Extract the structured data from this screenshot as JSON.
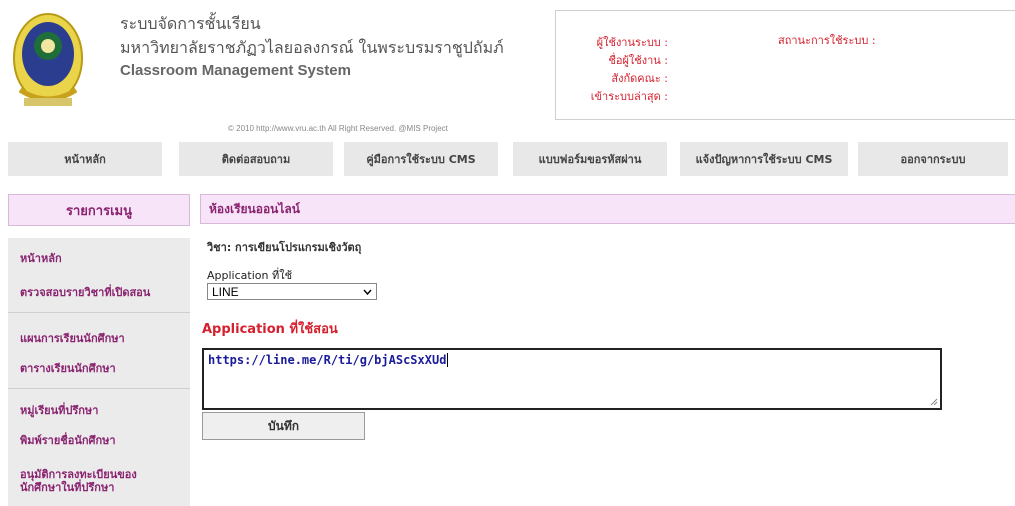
{
  "header": {
    "title_th": "ระบบจัดการชั้นเรียน",
    "university": "มหาวิทยาลัยราชภัฏวไลยอลงกรณ์ ในพระบรมราชูปถัมภ์",
    "title_en": "Classroom Management System",
    "copyright": "© 2010 http://www.vru.ac.th All Right Reserved. @MIS Project"
  },
  "user_box": {
    "user_label": "ผู้ใช้งานระบบ :",
    "name_label": "ชื่อผู้ใช้งาน :",
    "faculty_label": "สังกัดคณะ :",
    "last_login_label": "เข้าระบบล่าสุด :",
    "status_label": "สถานะการใช้ระบบ :"
  },
  "nav": {
    "home": "หน้าหลัก",
    "contact": "ติดต่อสอบถาม",
    "manual": "คู่มือการใช้ระบบ CMS",
    "password_form": "แบบฟอร์มขอรหัสผ่าน",
    "report": "แจ้งปัญหาการใช้ระบบ CMS",
    "logout": "ออกจากระบบ"
  },
  "sidebar": {
    "header": "รายการเมนู",
    "items": [
      "หน้าหลัก",
      "ตรวจสอบรายวิชาที่เปิดสอน",
      "แผนการเรียนนักศึกษา",
      "ตารางเรียนนักศึกษา",
      "หมู่เรียนที่ปรึกษา",
      "พิมพ์รายชื่อนักศึกษา",
      "อนุมัติการลงทะเบียนของ\nนักศึกษาในที่ปรึกษา"
    ]
  },
  "main": {
    "header": "ห้องเรียนออนไลน์",
    "subject": "วิชา: การเขียนโปรแกรมเชิงวัตถุ",
    "app_label": "Application ที่ใช้",
    "app_selected": "LINE",
    "teach_label": "Application ที่ใช้สอน",
    "url_value": "https://line.me/R/ti/g/bjAScSxXUd",
    "save_button": "บันทึก"
  }
}
